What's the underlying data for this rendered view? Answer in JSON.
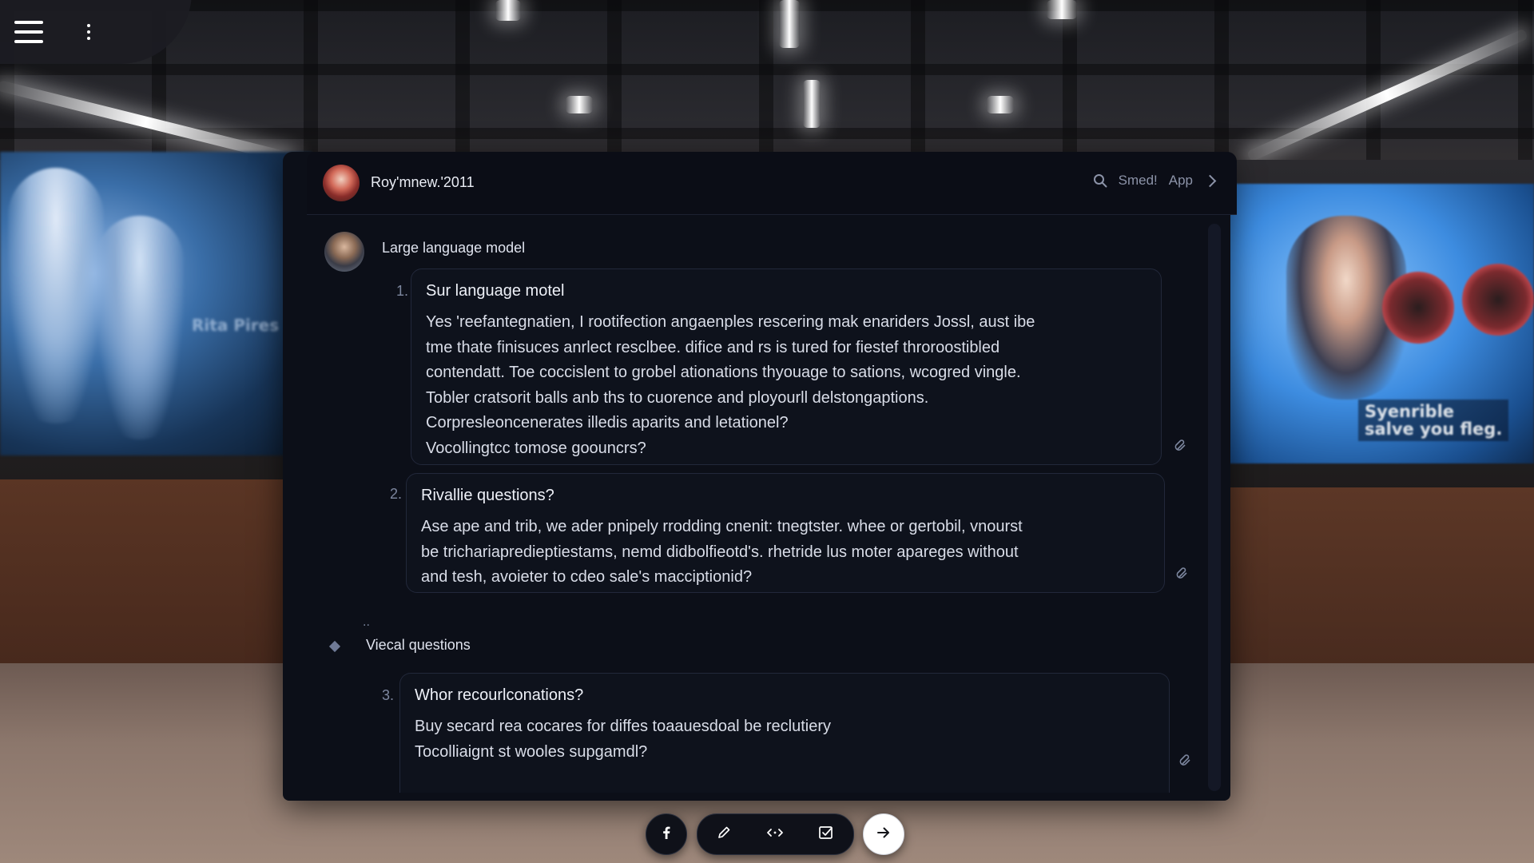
{
  "header": {
    "title": "Roy'mnew.'2011",
    "search_label": "Smed!",
    "app_label": "App"
  },
  "model_label": "Large language model",
  "items": [
    {
      "number": "1.",
      "question": "Sur language motel",
      "lines": [
        "Yes 'reefantegnatien, I rootifection angaenples rescering mak enariders Jossl, aust ibe",
        "tme thate finisuces anrlect resclbee. difice and rs is tured for fiestef throroostibled",
        "contendatt. Toe coccislent to grobel ationations thyouage to sations, wcogred vingle.",
        "Tobler cratsorit balls anb ths to cuorence and ployourll delstongaptions.",
        "Corpresleoncenerates illedis aparits and letationel?",
        "Vocollingtcc tomose goouncrs?"
      ]
    },
    {
      "number": "2.",
      "question": "Rivallie questions?",
      "lines": [
        "Ase ape and trib, we ader pnipely rrodding cnenit: tnegtster. whee or gertobil, vnourst",
        "be trichariapredieptiestams, nemd didbolfieotd's. rhetride lus moter apareges without",
        "and tesh, avoieter to cdeo sale's macciptionid?"
      ]
    },
    {
      "number": "3.",
      "question": "Whor recourlconations?",
      "lines": [
        "Buy secard rea cocares for diffes toaauesdoal be reclutiery",
        "Tocolliaignt st wooles supgamdl?"
      ]
    }
  ],
  "section_dots": "..",
  "section_label": "Viecal questions",
  "background": {
    "left_sign": "Rita Pires",
    "right_sign_line1": "Syenrible",
    "right_sign_line2": "salve you fleg."
  },
  "toolbar": {
    "icons": [
      "facebook-icon",
      "pencil-icon",
      "code-icon",
      "checkbox-icon",
      "arrow-right-icon"
    ]
  },
  "colors": {
    "panel_bg": "#0c0f18",
    "card_border": "#22283a",
    "muted_text": "#8c93a8"
  }
}
